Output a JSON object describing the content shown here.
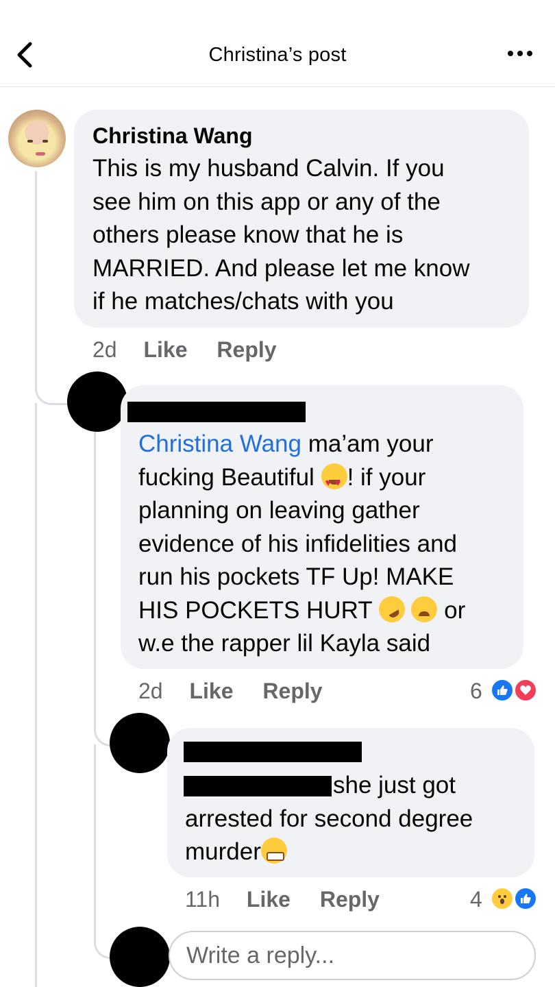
{
  "header": {
    "title": "Christina’s post"
  },
  "comments": [
    {
      "author": "Christina Wang",
      "text": "This is my husband Calvin. If you see him on this app or any of the others please know that he is MARRIED. And please let me know if he matches/chats with you",
      "lines": [
        "This is my husband Calvin. If you",
        "see him on this app or any of the",
        "others please know that he is",
        "MARRIED. And please let me know",
        "if he matches/chats with you"
      ],
      "time": "2d",
      "like": "Like",
      "reply": "Reply"
    },
    {
      "mention": "Christina Wang",
      "lines": [
        " ma’am your",
        "fucking Beautiful ",
        "! if your",
        "planning on leaving gather",
        "evidence of his infidelities and",
        "run his pockets TF Up! MAKE",
        "HIS POCKETS HURT ",
        " or",
        "w.e the rapper lil Kayla said"
      ],
      "time": "2d",
      "like": "Like",
      "reply": "Reply",
      "reaction_count": "6",
      "reactions": [
        "like",
        "love"
      ]
    },
    {
      "lines": [
        "she just got",
        "arrested for second degree",
        "murder"
      ],
      "time": "11h",
      "like": "Like",
      "reply": "Reply",
      "reaction_count": "4",
      "reactions": [
        "wow",
        "like"
      ]
    }
  ],
  "composer": {
    "placeholder": "Write a reply..."
  }
}
